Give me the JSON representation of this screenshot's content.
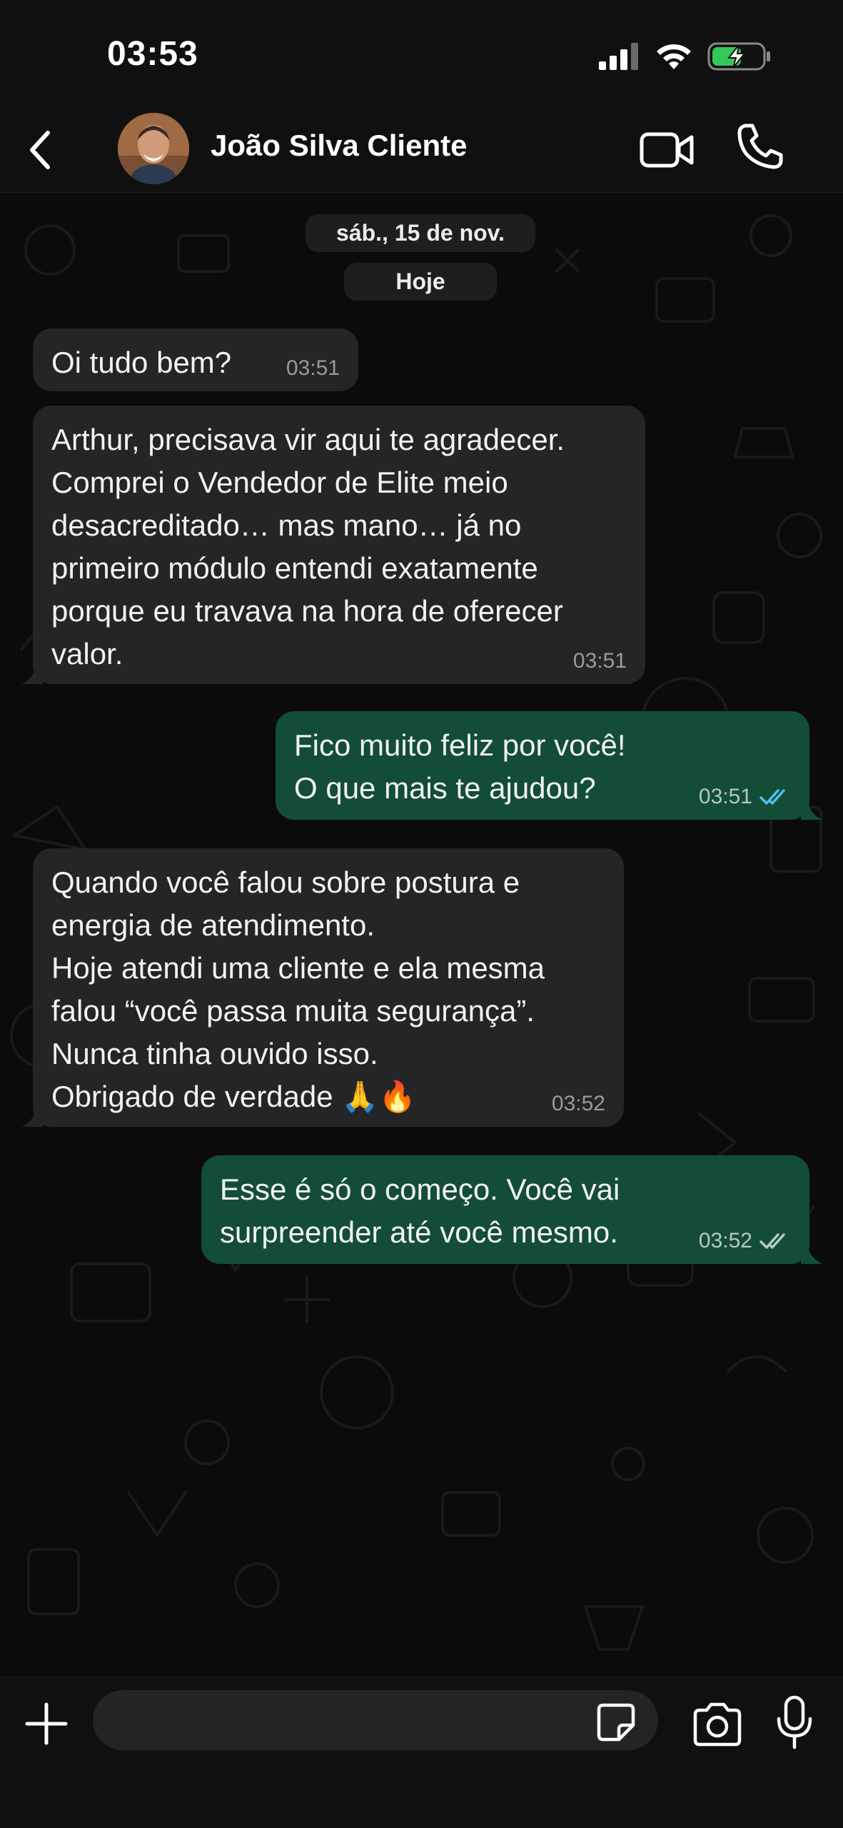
{
  "status_bar": {
    "time": "03:53",
    "icons": [
      "signal-icon",
      "wifi-icon",
      "battery-charging-icon"
    ]
  },
  "header": {
    "back_icon": "chevron-left-icon",
    "contact_name": "João Silva Cliente",
    "actions": [
      "video-call-icon",
      "phone-call-icon"
    ]
  },
  "chat": {
    "date_label": "sáb., 15 de nov.",
    "today_label": "Hoje",
    "messages": [
      {
        "direction": "incoming",
        "text": "Oi tudo bem?",
        "time": "03:51"
      },
      {
        "direction": "incoming",
        "text": "Arthur, precisava vir aqui te agradecer.\nComprei o Vendedor de Elite meio\ndesacreditado… mas mano… já no\nprimeiro módulo entendi exatamente\nporque eu travava na hora de oferecer\nvalor.",
        "time": "03:51"
      },
      {
        "direction": "outgoing",
        "text": "Fico muito feliz por você!\nO que mais te ajudou?",
        "time": "03:51",
        "status": "read",
        "status_color": "#53bdeb"
      },
      {
        "direction": "incoming",
        "text": "Quando você falou sobre postura e\nenergia de atendimento.\nHoje atendi uma cliente e ela mesma\nfalou “você passa muita segurança”.\nNunca tinha ouvido isso.\nObrigado de verdade 🙏🔥",
        "time": "03:52"
      },
      {
        "direction": "outgoing",
        "text": "Esse é só o começo. Você vai\nsurpreender até você mesmo.",
        "time": "03:52",
        "status": "delivered",
        "status_color": "#b8c8c0"
      }
    ]
  },
  "input_bar": {
    "placeholder": "",
    "icons": [
      "plus-icon",
      "sticker-icon",
      "camera-icon",
      "microphone-icon"
    ]
  },
  "colors": {
    "background": "#0b0b0c",
    "incoming_bubble": "#242526",
    "outgoing_bubble": "#134d38",
    "read_tick": "#53bdeb",
    "battery_charge": "#34c759"
  }
}
